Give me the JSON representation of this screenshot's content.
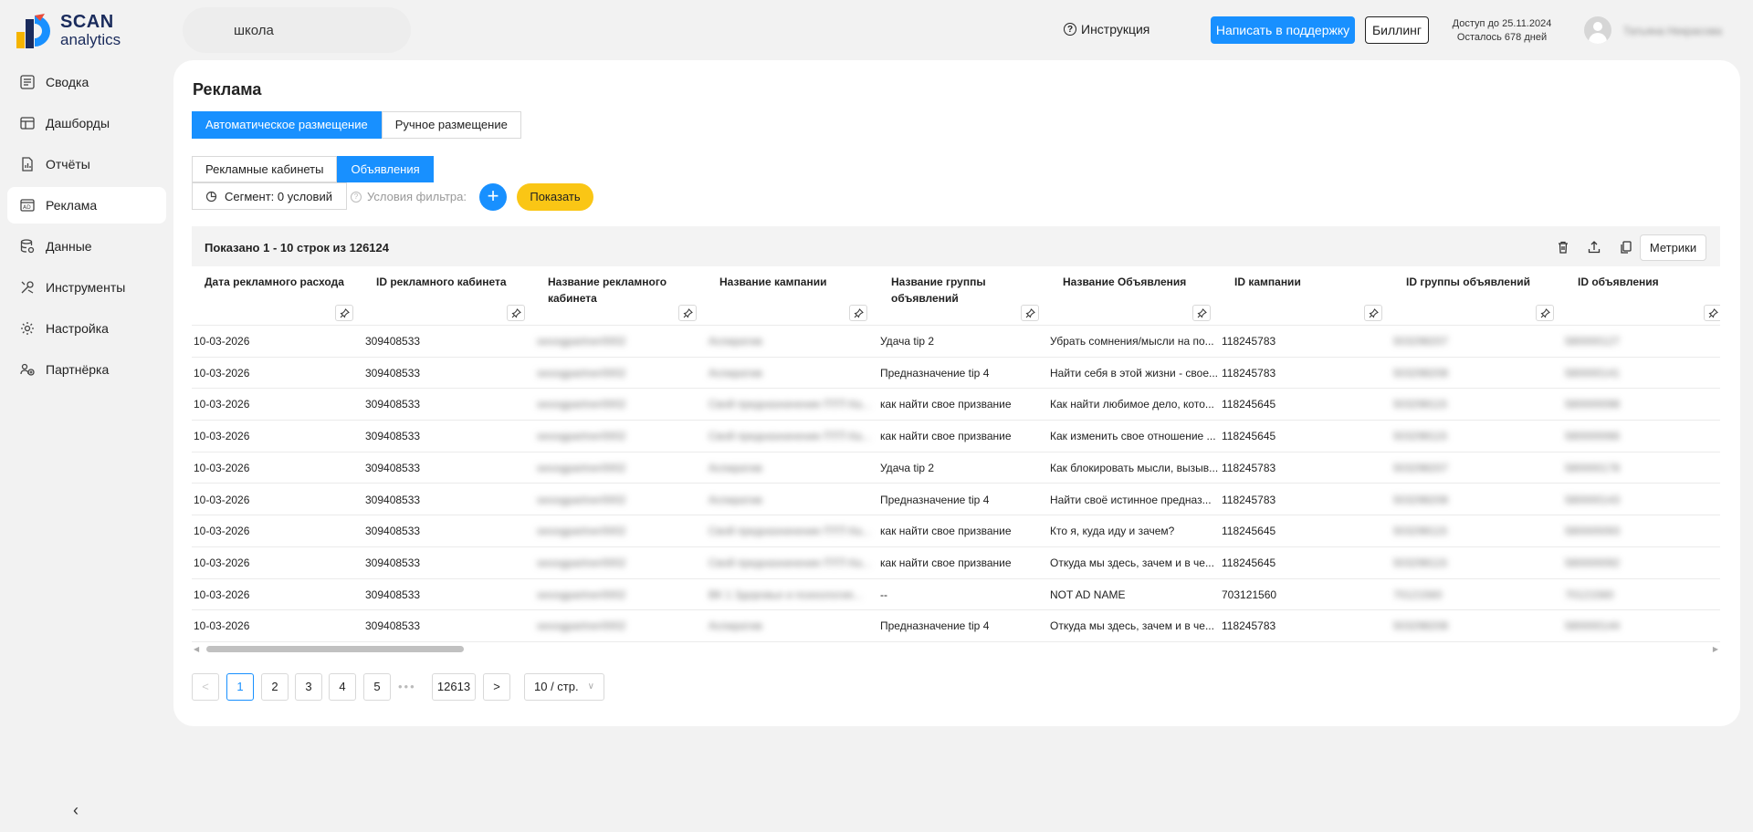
{
  "brand": {
    "line1": "SCAN",
    "line2": "analytics"
  },
  "header": {
    "project": "школа",
    "instruction": "Инструкция",
    "support_btn": "Написать в поддержку",
    "billing_btn": "Биллинг",
    "access_line1": "Доступ до 25.11.2024",
    "access_line2": "Осталось 678 дней",
    "user_name": "Татьяна Некрасова"
  },
  "sidebar": [
    {
      "label": "Сводка",
      "icon": "summary-icon"
    },
    {
      "label": "Дашборды",
      "icon": "dashboard-icon"
    },
    {
      "label": "Отчёты",
      "icon": "report-icon"
    },
    {
      "label": "Реклама",
      "icon": "ads-icon",
      "active": true
    },
    {
      "label": "Данные",
      "icon": "database-icon"
    },
    {
      "label": "Инструменты",
      "icon": "tools-icon"
    },
    {
      "label": "Настройка",
      "icon": "settings-icon"
    },
    {
      "label": "Партнёрка",
      "icon": "partner-icon"
    }
  ],
  "page": {
    "title": "Реклама",
    "placement_tabs": [
      "Автоматическое размещение",
      "Ручное размещение"
    ],
    "view_tabs": [
      "Рекламные кабинеты",
      "Объявления"
    ],
    "segment": "Сегмент: 0 условий",
    "filter_label": "Условия фильтра:",
    "add": "+",
    "show_btn": "Показать"
  },
  "table": {
    "count_text": "Показано 1 - 10 строк из 126124",
    "metrics_btn": "Метрики",
    "columns": [
      "Дата рекламного расхода",
      "ID рекламного кабинета",
      "Название рекламного кабинета",
      "Название кампании",
      "Название группы объявлений",
      "Название Объявления",
      "ID кампании",
      "ID группы объявлений",
      "ID объявления"
    ],
    "rows": [
      [
        "10-03-2026",
        "309408533",
        "seoogpartner0002",
        "Аспиратив",
        "Удача tip 2",
        "Убрать сомнения/мысли на по...",
        "118245783",
        "503298207",
        "580000127"
      ],
      [
        "10-03-2026",
        "309408533",
        "seoogpartner0002",
        "Аспиратив",
        "Предназначение tip 4",
        "Найти себя в этой жизни - свое...",
        "118245783",
        "503298208",
        "580000141"
      ],
      [
        "10-03-2026",
        "309408533",
        "seoogpartner0002",
        "Свой предназначение ПТП Ка...",
        "как найти свое призвание",
        "Как найти любимое дело, кото...",
        "118245645",
        "503298115",
        "580000098"
      ],
      [
        "10-03-2026",
        "309408533",
        "seoogpartner0002",
        "Свой предназначение ПТП Ка...",
        "как найти свое призвание",
        "Как изменить свое отношение ...",
        "118245645",
        "503298115",
        "580000066"
      ],
      [
        "10-03-2026",
        "309408533",
        "seoogpartner0002",
        "Аспиратив",
        "Удача tip 2",
        "Как блокировать мысли, вызыв...",
        "118245783",
        "503298207",
        "580000178"
      ],
      [
        "10-03-2026",
        "309408533",
        "seoogpartner0002",
        "Аспиратив",
        "Предназначение tip 4",
        "Найти своё истинное предназ...",
        "118245783",
        "503298208",
        "580000143"
      ],
      [
        "10-03-2026",
        "309408533",
        "seoogpartner0002",
        "Свой предназначение ПТП Ка...",
        "как найти свое призвание",
        "Кто я, куда иду и зачем?",
        "118245645",
        "503298115",
        "580000093"
      ],
      [
        "10-03-2026",
        "309408533",
        "seoogpartner0002",
        "Свой предназначение ПТП Ка...",
        "как найти свое призвание",
        "Откуда мы здесь, зачем и в че...",
        "118245645",
        "503298115",
        "580000092"
      ],
      [
        "10-03-2026",
        "309408533",
        "seoogpartner0002",
        "ВК 1 Здоровье и психология...",
        "--",
        "NOT AD NAME",
        "703121560",
        "70121560",
        "70121560"
      ],
      [
        "10-03-2026",
        "309408533",
        "seoogpartner0002",
        "Аспиратив",
        "Предназначение tip 4",
        "Откуда мы здесь, зачем и в че...",
        "118245783",
        "503298208",
        "580000144"
      ]
    ]
  },
  "pagination": {
    "prev": "<",
    "pages": [
      "1",
      "2",
      "3",
      "4",
      "5"
    ],
    "dots": "•••",
    "last": "12613",
    "next": ">",
    "per_page": "10 / стр."
  }
}
